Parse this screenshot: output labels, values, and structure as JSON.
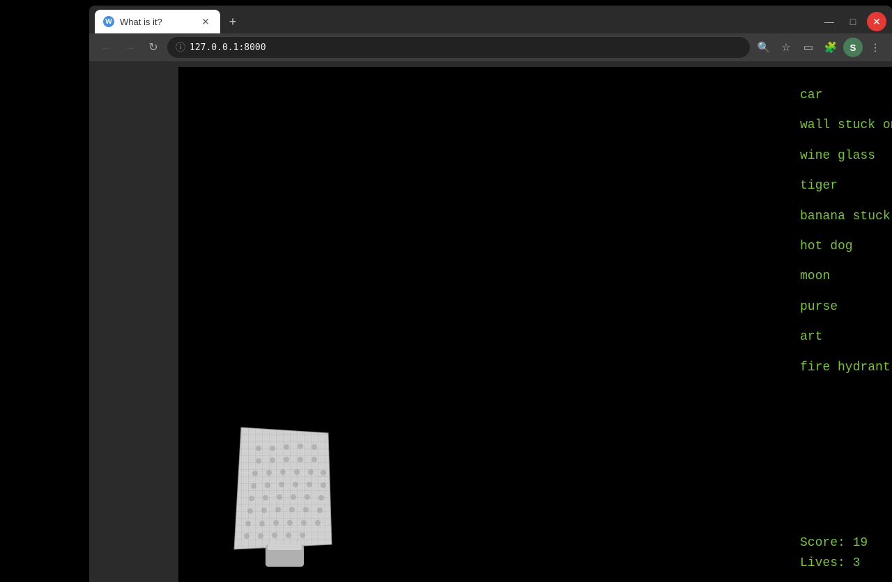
{
  "browser": {
    "tab_title": "What is it?",
    "new_tab_label": "+",
    "address": "127.0.0.1",
    "port": ":8000",
    "favicon_letter": "W",
    "profile_letter": "S"
  },
  "nav": {
    "back_label": "←",
    "forward_label": "→",
    "reload_label": "↻"
  },
  "window_controls": {
    "minimize": "—",
    "maximize": "□",
    "close": "✕"
  },
  "game": {
    "answers": [
      {
        "text": "car"
      },
      {
        "text": "wall stuck on banana"
      },
      {
        "text": "wine glass"
      },
      {
        "text": "tiger"
      },
      {
        "text": "banana stuck on wall"
      },
      {
        "text": "hot dog"
      },
      {
        "text": "moon"
      },
      {
        "text": "purse"
      },
      {
        "text": "art"
      },
      {
        "text": "fire hydrant"
      }
    ],
    "score_label": "Score: 19",
    "lives_label": "Lives: 3"
  }
}
